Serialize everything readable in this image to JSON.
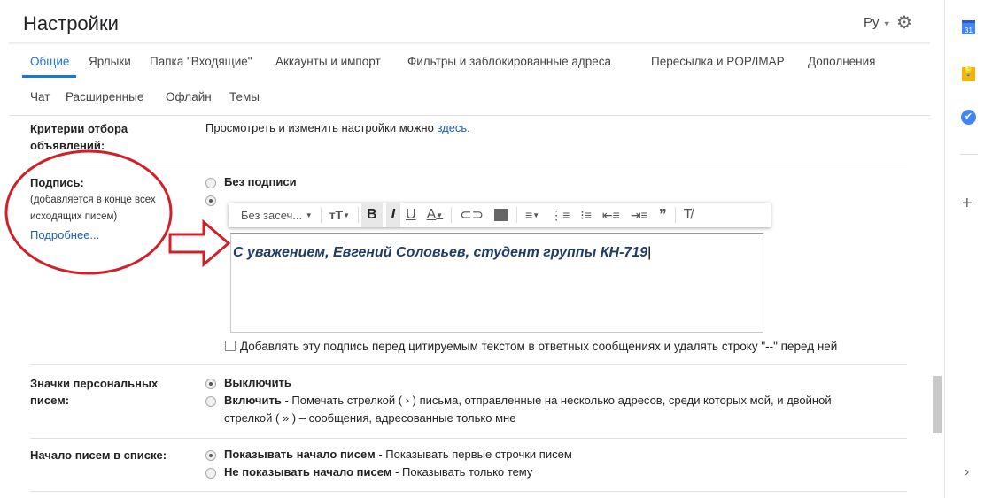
{
  "header": {
    "title": "Настройки",
    "language": "Ру",
    "gear_icon": "gear-icon"
  },
  "tabs": [
    {
      "label": "Общие",
      "active": true
    },
    {
      "label": "Ярлыки"
    },
    {
      "label": "Папка \"Входящие\""
    },
    {
      "label": "Аккаунты и импорт"
    },
    {
      "label": "Фильтры и заблокированные адреса"
    },
    {
      "label": "Пересылка и POP/IMAP"
    },
    {
      "label": "Дополнения"
    },
    {
      "label": "Чат"
    },
    {
      "label": "Расширенные"
    },
    {
      "label": "Офлайн"
    },
    {
      "label": "Темы"
    }
  ],
  "ads": {
    "label": "Критерии отбора объявлений:",
    "text": "Просмотреть и изменить настройки можно ",
    "link": "здесь",
    "end": "."
  },
  "signature": {
    "label": "Подпись:",
    "hint": "(добавляется в конце всех исходящих писем)",
    "more": "Подробнее...",
    "no_sig": "Без подписи",
    "font": "Без засеч...",
    "text": "С уважением, Евгений Соловьев, студент группы КН-719",
    "checkbox": "Добавлять эту подпись перед цитируемым текстом в ответных сообщениях и удалять строку \"--\" перед ней",
    "annotation_color": "#d0202a"
  },
  "badges": {
    "label": "Значки персональных писем:",
    "off": "Выключить",
    "on": "Включить",
    "on_desc": " - Помечать стрелкой ( › ) письма, отправленные на несколько адресов, среди которых мой, и двойной",
    "on_desc2": "стрелкой ( » ) – сообщения, адресованные только мне"
  },
  "snippets": {
    "label": "Начало писем в списке:",
    "show": "Показывать начало писем",
    "show_desc": " - Показывать первые строчки писем",
    "hide": "Не показывать начало писем",
    "hide_desc": " - Показывать только тему"
  },
  "sidebar": {
    "calendar_day": "31"
  }
}
